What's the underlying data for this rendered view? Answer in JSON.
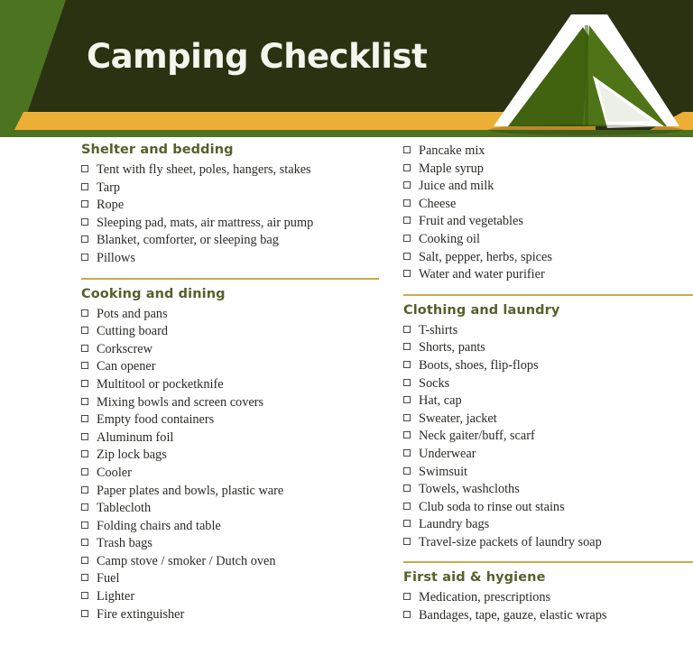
{
  "header": {
    "title": "Camping Checklist",
    "tent_icon": "tent-icon",
    "colors": {
      "light_green": "#4C7320",
      "dark_green": "#2B3211",
      "gold_stripe": "#EDAE36",
      "rule_gold": "#C9A94E",
      "heading_olive": "#56602C",
      "title_text": "#F4F5EC"
    }
  },
  "left_column": [
    {
      "id": "shelter-and-bedding",
      "title": "Shelter and bedding",
      "rule_above": false,
      "items": [
        "Tent with fly sheet, poles, hangers, stakes",
        "Tarp",
        "Rope",
        "Sleeping pad, mats, air mattress, air pump",
        "Blanket, comforter, or sleeping bag",
        "Pillows"
      ]
    },
    {
      "id": "cooking-and-dining",
      "title": "Cooking and dining",
      "rule_above": true,
      "items": [
        "Pots and pans",
        "Cutting board",
        "Corkscrew",
        "Can opener",
        "Multitool or pocketknife",
        "Mixing bowls and screen covers",
        "Empty food containers",
        "Aluminum foil",
        "Zip lock bags",
        "Cooler",
        "Paper plates and bowls, plastic ware",
        "Tablecloth",
        "Folding chairs and table",
        "Trash bags",
        "Camp stove / smoker / Dutch oven",
        "Fuel",
        "Lighter",
        "Fire extinguisher"
      ]
    }
  ],
  "right_column": [
    {
      "id": "food-continued",
      "title": "",
      "rule_above": false,
      "items": [
        "Pancake mix",
        "Maple syrup",
        "Juice and milk",
        "Cheese",
        "Fruit and vegetables",
        "Cooking oil",
        "Salt, pepper, herbs, spices",
        "Water and water purifier"
      ]
    },
    {
      "id": "clothing-and-laundry",
      "title": "Clothing and laundry",
      "rule_above": true,
      "items": [
        "T-shirts",
        "Shorts, pants",
        "Boots, shoes, flip-flops",
        "Socks",
        "Hat, cap",
        "Sweater, jacket",
        "Neck gaiter/buff, scarf",
        "Underwear",
        "Swimsuit",
        "Towels, washcloths",
        "Club soda to rinse out stains",
        "Laundry bags",
        "Travel-size packets of laundry soap"
      ]
    },
    {
      "id": "first-aid-and-hygiene",
      "title": "First aid & hygiene",
      "rule_above": true,
      "items": [
        "Medication, prescriptions",
        "Bandages, tape, gauze, elastic wraps"
      ]
    }
  ]
}
